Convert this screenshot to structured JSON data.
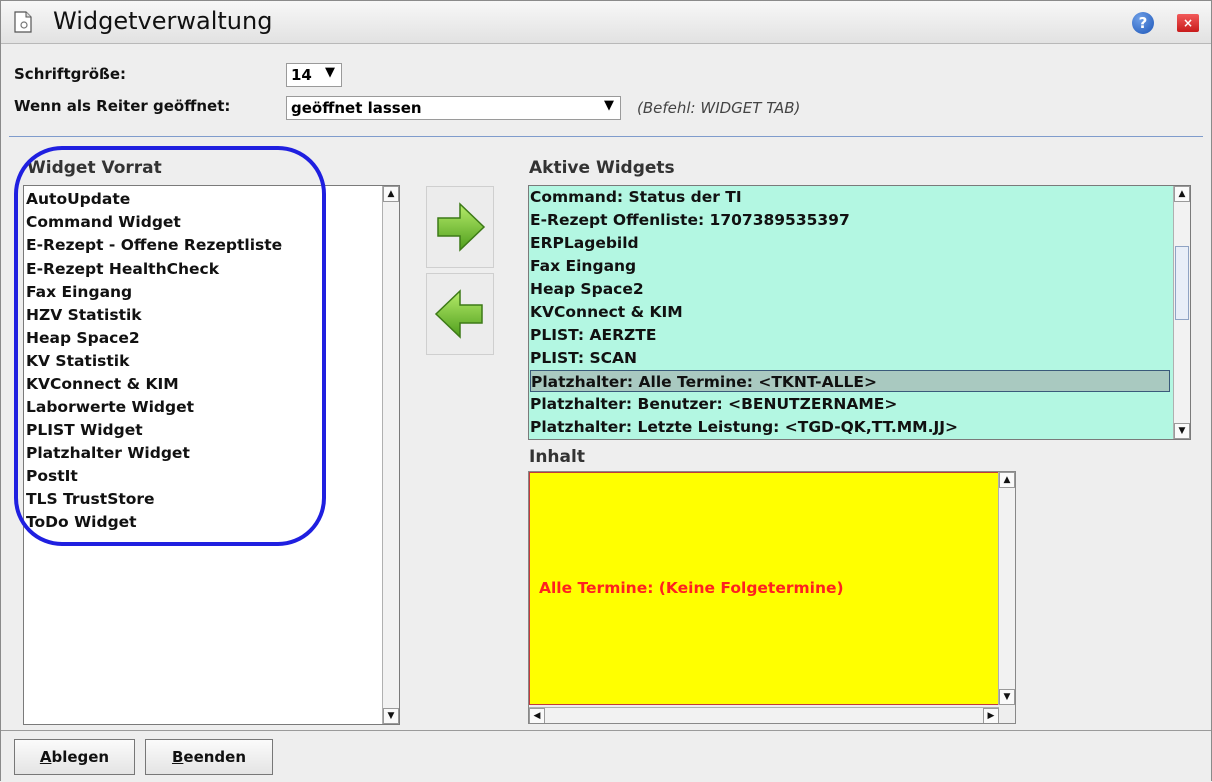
{
  "window": {
    "title": "Widgetverwaltung",
    "help_label": "?",
    "close_label": "×"
  },
  "settings": {
    "font_size_label": "Schriftgröße:",
    "font_size_value": "14",
    "tab_label": "Wenn als Reiter geöffnet:",
    "tab_value": "geöffnet lassen",
    "tab_hint": "(Befehl: WIDGET TAB)"
  },
  "widget_pool": {
    "title": "Widget Vorrat",
    "items": [
      "AutoUpdate",
      "Command Widget",
      "E-Rezept - Offene Rezeptliste",
      "E-Rezept HealthCheck",
      "Fax Eingang",
      "HZV Statistik",
      "Heap Space2",
      "KV Statistik",
      "KVConnect & KIM",
      "Laborwerte Widget",
      "PLIST Widget",
      "Platzhalter Widget",
      "PostIt",
      "TLS TrustStore",
      "ToDo Widget"
    ]
  },
  "active_widgets": {
    "title": "Aktive Widgets",
    "items": [
      "Command: Status der TI",
      "E-Rezept Offenliste: 1707389535397",
      "ERPLagebild",
      "Fax Eingang",
      "Heap Space2",
      "KVConnect & KIM",
      "PLIST: AERZTE",
      "PLIST: SCAN",
      "Platzhalter: Alle Termine: <TKNT-ALLE>",
      "Platzhalter: Benutzer: <BENUTZERNAME>",
      "Platzhalter: Letzte Leistung: <TGD-QK,TT.MM.JJ>"
    ],
    "selected_index": 8,
    "background_color": "#b3f7e2"
  },
  "content": {
    "title": "Inhalt",
    "text": "Alle Termine: (Keine Folgetermine)",
    "background_color": "#ffff00",
    "text_color": "#ff2020"
  },
  "buttons": {
    "save_label_first": "A",
    "save_label_rest": "blegen",
    "exit_label_first": "B",
    "exit_label_rest": "eenden"
  }
}
